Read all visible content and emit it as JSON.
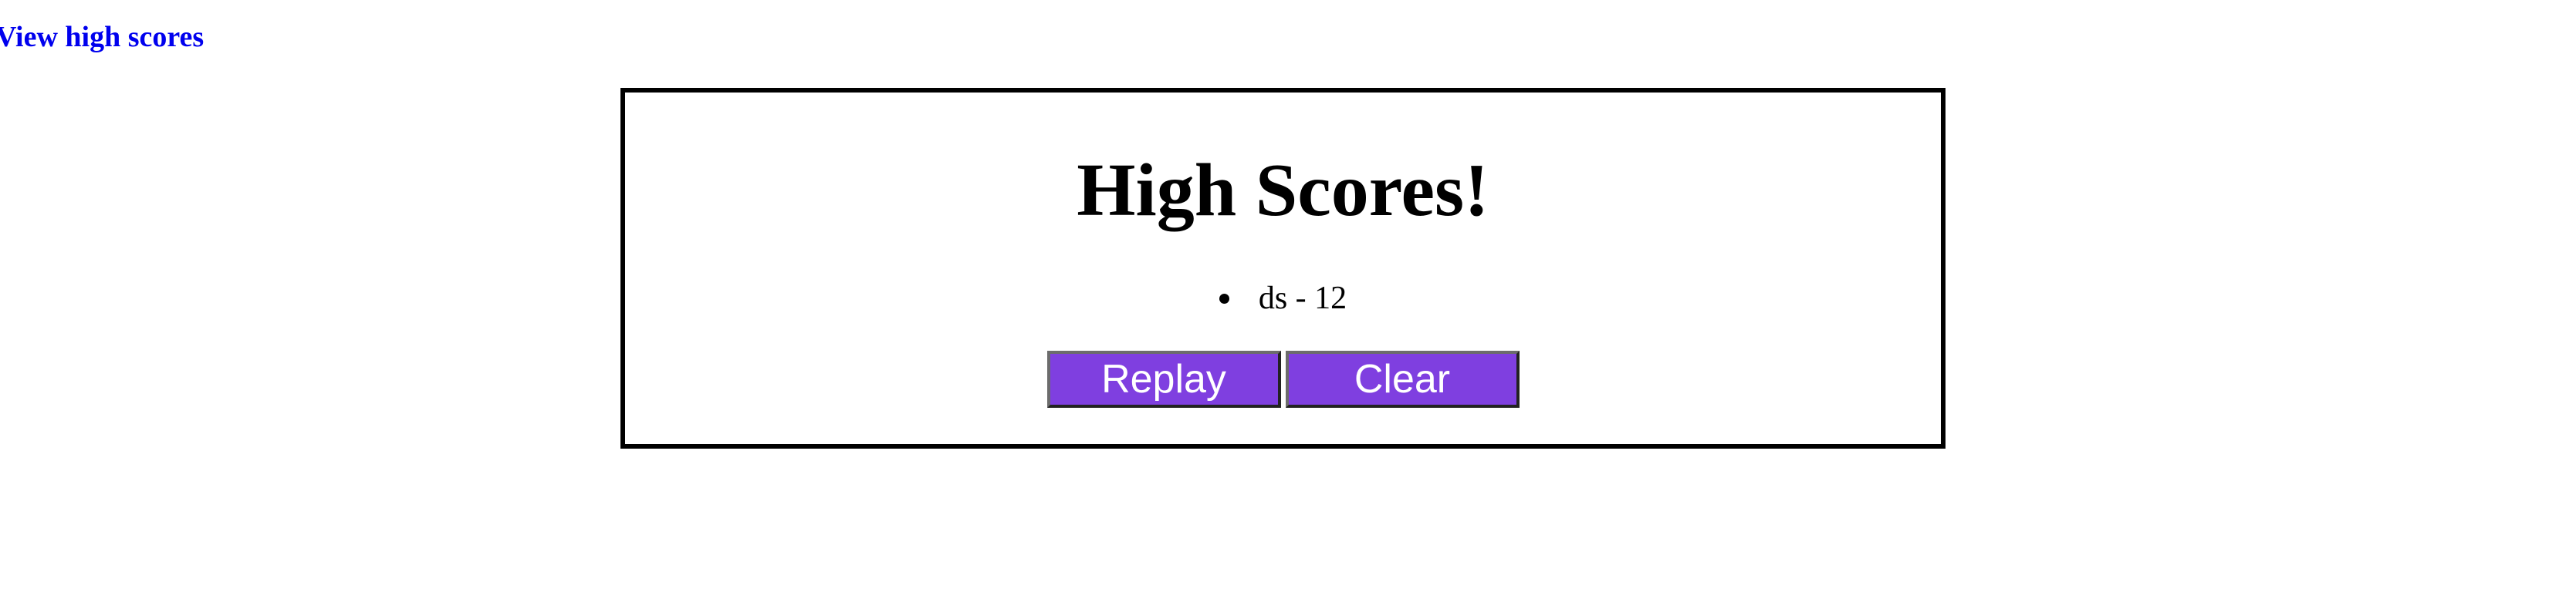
{
  "header": {
    "high_scores_link": "View high scores"
  },
  "card": {
    "title": "High Scores!",
    "scores": [
      {
        "text": "ds - 12"
      }
    ],
    "buttons": {
      "replay": "Replay",
      "clear": "Clear"
    }
  },
  "colors": {
    "link": "#0000ee",
    "button_bg": "#7f3fe0",
    "button_text": "#ffffff",
    "border": "#000000"
  }
}
